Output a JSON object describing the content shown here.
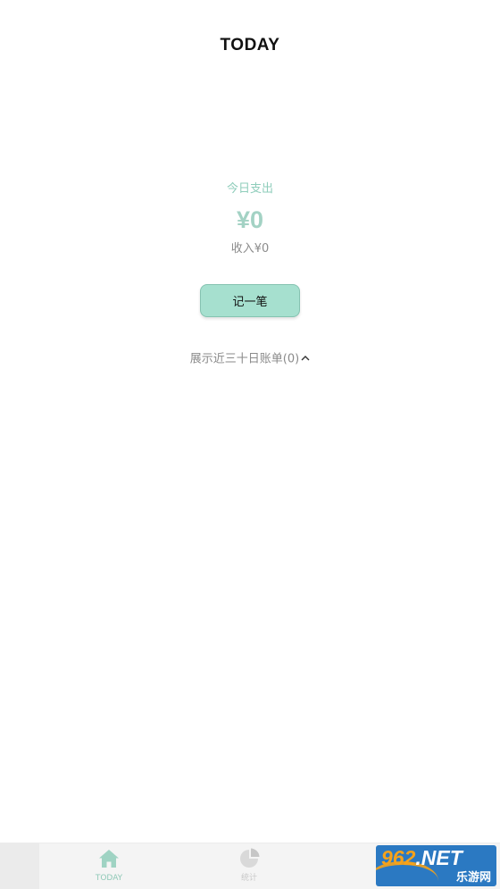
{
  "header": {
    "title": "TODAY"
  },
  "summary": {
    "expense_label": "今日支出",
    "expense_amount": "¥0",
    "income_line": "收入¥0"
  },
  "actions": {
    "record_label": "记一笔"
  },
  "history": {
    "toggle_label": "展示近三十日账单(0)",
    "chevron": "chevron-up-icon"
  },
  "tabbar": {
    "tabs": [
      {
        "label": "TODAY",
        "icon": "home-icon",
        "active": true
      },
      {
        "label": "统计",
        "icon": "stats-icon",
        "active": false
      }
    ]
  },
  "watermark": {
    "top_text_num": "962",
    "top_text_suffix": ".NET",
    "bottom_text": "乐游网"
  },
  "colors": {
    "accent": "#a6e0cf",
    "accent_text": "#8fcdbb",
    "amount": "#a3d2c4",
    "inactive": "#c8c8c8"
  }
}
